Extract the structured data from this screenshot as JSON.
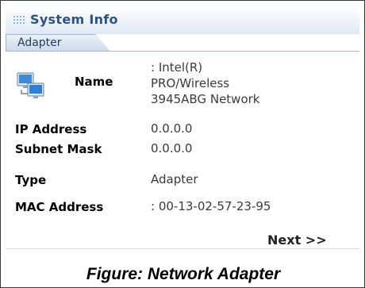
{
  "window": {
    "title": "System Info",
    "tab_label": "Adapter"
  },
  "icons": {
    "grip": "drag-grip-icon",
    "adapter": "network-adapter-icon"
  },
  "fields": {
    "name": {
      "label": "Name",
      "value_lines": [
        ": Intel(R)",
        "PRO/Wireless",
        "3945ABG Network"
      ]
    },
    "ip_address": {
      "label": "IP Address",
      "value": "0.0.0.0"
    },
    "subnet_mask": {
      "label": "Subnet Mask",
      "value": "0.0.0.0"
    },
    "type": {
      "label": "Type",
      "value": "Adapter"
    },
    "mac_address": {
      "label": "MAC Address",
      "value": ": 00-13-02-57-23-95"
    }
  },
  "navigation": {
    "next_label": "Next >>"
  },
  "caption": "Figure: Network Adapter",
  "colors": {
    "title_text": "#2c5386",
    "titlebar_bottom": "#dfe8f3",
    "tab_border": "#9db6d2",
    "value_text": "#3a3a3a"
  }
}
